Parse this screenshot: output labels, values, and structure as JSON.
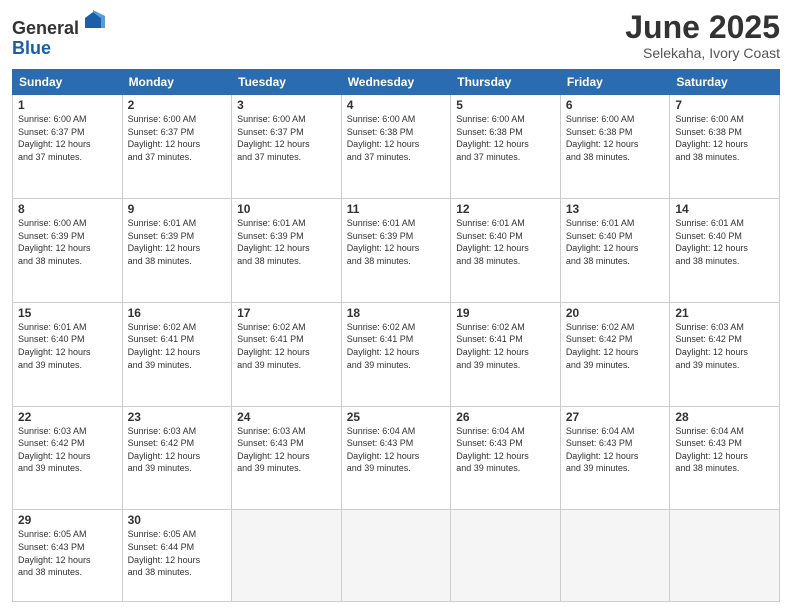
{
  "logo": {
    "general": "General",
    "blue": "Blue"
  },
  "title": "June 2025",
  "location": "Selekaha, Ivory Coast",
  "days_header": [
    "Sunday",
    "Monday",
    "Tuesday",
    "Wednesday",
    "Thursday",
    "Friday",
    "Saturday"
  ],
  "weeks": [
    [
      {
        "day": "1",
        "info": "Sunrise: 6:00 AM\nSunset: 6:37 PM\nDaylight: 12 hours\nand 37 minutes."
      },
      {
        "day": "2",
        "info": "Sunrise: 6:00 AM\nSunset: 6:37 PM\nDaylight: 12 hours\nand 37 minutes."
      },
      {
        "day": "3",
        "info": "Sunrise: 6:00 AM\nSunset: 6:37 PM\nDaylight: 12 hours\nand 37 minutes."
      },
      {
        "day": "4",
        "info": "Sunrise: 6:00 AM\nSunset: 6:38 PM\nDaylight: 12 hours\nand 37 minutes."
      },
      {
        "day": "5",
        "info": "Sunrise: 6:00 AM\nSunset: 6:38 PM\nDaylight: 12 hours\nand 37 minutes."
      },
      {
        "day": "6",
        "info": "Sunrise: 6:00 AM\nSunset: 6:38 PM\nDaylight: 12 hours\nand 38 minutes."
      },
      {
        "day": "7",
        "info": "Sunrise: 6:00 AM\nSunset: 6:38 PM\nDaylight: 12 hours\nand 38 minutes."
      }
    ],
    [
      {
        "day": "8",
        "info": "Sunrise: 6:00 AM\nSunset: 6:39 PM\nDaylight: 12 hours\nand 38 minutes."
      },
      {
        "day": "9",
        "info": "Sunrise: 6:01 AM\nSunset: 6:39 PM\nDaylight: 12 hours\nand 38 minutes."
      },
      {
        "day": "10",
        "info": "Sunrise: 6:01 AM\nSunset: 6:39 PM\nDaylight: 12 hours\nand 38 minutes."
      },
      {
        "day": "11",
        "info": "Sunrise: 6:01 AM\nSunset: 6:39 PM\nDaylight: 12 hours\nand 38 minutes."
      },
      {
        "day": "12",
        "info": "Sunrise: 6:01 AM\nSunset: 6:40 PM\nDaylight: 12 hours\nand 38 minutes."
      },
      {
        "day": "13",
        "info": "Sunrise: 6:01 AM\nSunset: 6:40 PM\nDaylight: 12 hours\nand 38 minutes."
      },
      {
        "day": "14",
        "info": "Sunrise: 6:01 AM\nSunset: 6:40 PM\nDaylight: 12 hours\nand 38 minutes."
      }
    ],
    [
      {
        "day": "15",
        "info": "Sunrise: 6:01 AM\nSunset: 6:40 PM\nDaylight: 12 hours\nand 39 minutes."
      },
      {
        "day": "16",
        "info": "Sunrise: 6:02 AM\nSunset: 6:41 PM\nDaylight: 12 hours\nand 39 minutes."
      },
      {
        "day": "17",
        "info": "Sunrise: 6:02 AM\nSunset: 6:41 PM\nDaylight: 12 hours\nand 39 minutes."
      },
      {
        "day": "18",
        "info": "Sunrise: 6:02 AM\nSunset: 6:41 PM\nDaylight: 12 hours\nand 39 minutes."
      },
      {
        "day": "19",
        "info": "Sunrise: 6:02 AM\nSunset: 6:41 PM\nDaylight: 12 hours\nand 39 minutes."
      },
      {
        "day": "20",
        "info": "Sunrise: 6:02 AM\nSunset: 6:42 PM\nDaylight: 12 hours\nand 39 minutes."
      },
      {
        "day": "21",
        "info": "Sunrise: 6:03 AM\nSunset: 6:42 PM\nDaylight: 12 hours\nand 39 minutes."
      }
    ],
    [
      {
        "day": "22",
        "info": "Sunrise: 6:03 AM\nSunset: 6:42 PM\nDaylight: 12 hours\nand 39 minutes."
      },
      {
        "day": "23",
        "info": "Sunrise: 6:03 AM\nSunset: 6:42 PM\nDaylight: 12 hours\nand 39 minutes."
      },
      {
        "day": "24",
        "info": "Sunrise: 6:03 AM\nSunset: 6:43 PM\nDaylight: 12 hours\nand 39 minutes."
      },
      {
        "day": "25",
        "info": "Sunrise: 6:04 AM\nSunset: 6:43 PM\nDaylight: 12 hours\nand 39 minutes."
      },
      {
        "day": "26",
        "info": "Sunrise: 6:04 AM\nSunset: 6:43 PM\nDaylight: 12 hours\nand 39 minutes."
      },
      {
        "day": "27",
        "info": "Sunrise: 6:04 AM\nSunset: 6:43 PM\nDaylight: 12 hours\nand 39 minutes."
      },
      {
        "day": "28",
        "info": "Sunrise: 6:04 AM\nSunset: 6:43 PM\nDaylight: 12 hours\nand 38 minutes."
      }
    ],
    [
      {
        "day": "29",
        "info": "Sunrise: 6:05 AM\nSunset: 6:43 PM\nDaylight: 12 hours\nand 38 minutes."
      },
      {
        "day": "30",
        "info": "Sunrise: 6:05 AM\nSunset: 6:44 PM\nDaylight: 12 hours\nand 38 minutes."
      },
      {
        "day": "",
        "info": ""
      },
      {
        "day": "",
        "info": ""
      },
      {
        "day": "",
        "info": ""
      },
      {
        "day": "",
        "info": ""
      },
      {
        "day": "",
        "info": ""
      }
    ]
  ]
}
